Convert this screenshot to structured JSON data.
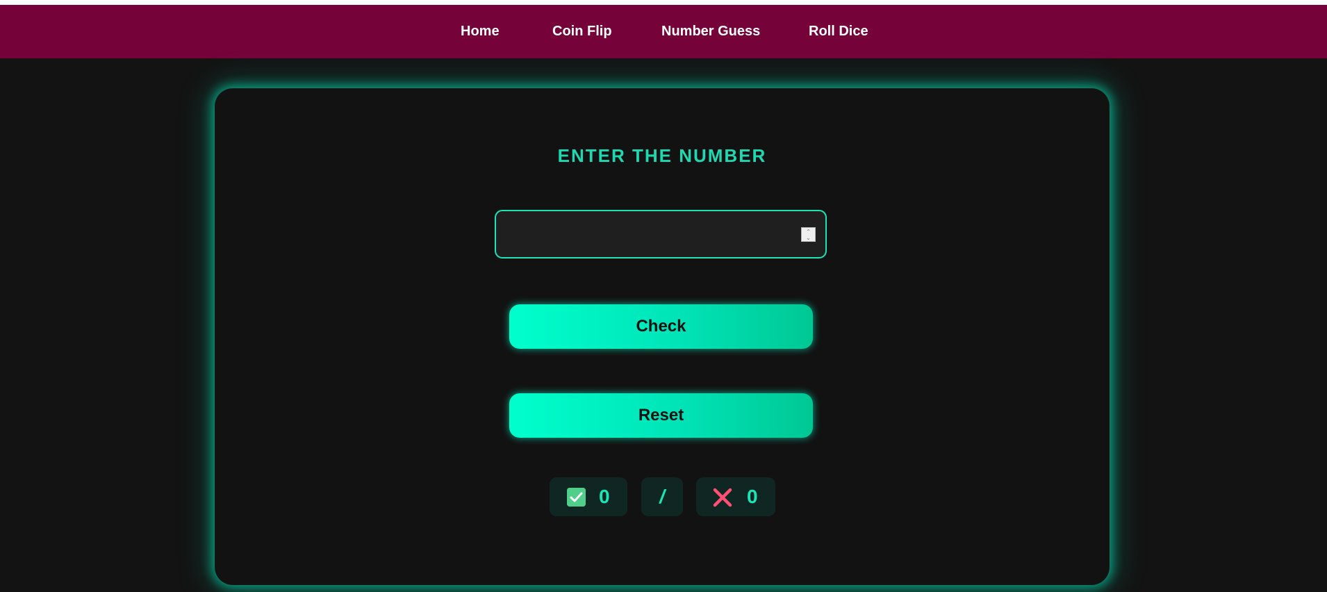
{
  "nav": {
    "items": [
      {
        "label": "Home"
      },
      {
        "label": "Coin Flip"
      },
      {
        "label": "Number Guess"
      },
      {
        "label": "Roll Dice"
      }
    ]
  },
  "game": {
    "title": "ENTER THE NUMBER",
    "input_value": "",
    "check_label": "Check",
    "reset_label": "Reset",
    "correct_count": "0",
    "separator": "/",
    "wrong_count": "0"
  },
  "colors": {
    "navbar": "#75033a",
    "accent": "#19e6b8",
    "background": "#131313",
    "correct_icon": "#4fcf8a",
    "wrong_icon": "#ff4f73"
  },
  "icons": {
    "correct": "check-mark-icon",
    "wrong": "cross-mark-icon",
    "spinner": "number-spinner-icon"
  }
}
